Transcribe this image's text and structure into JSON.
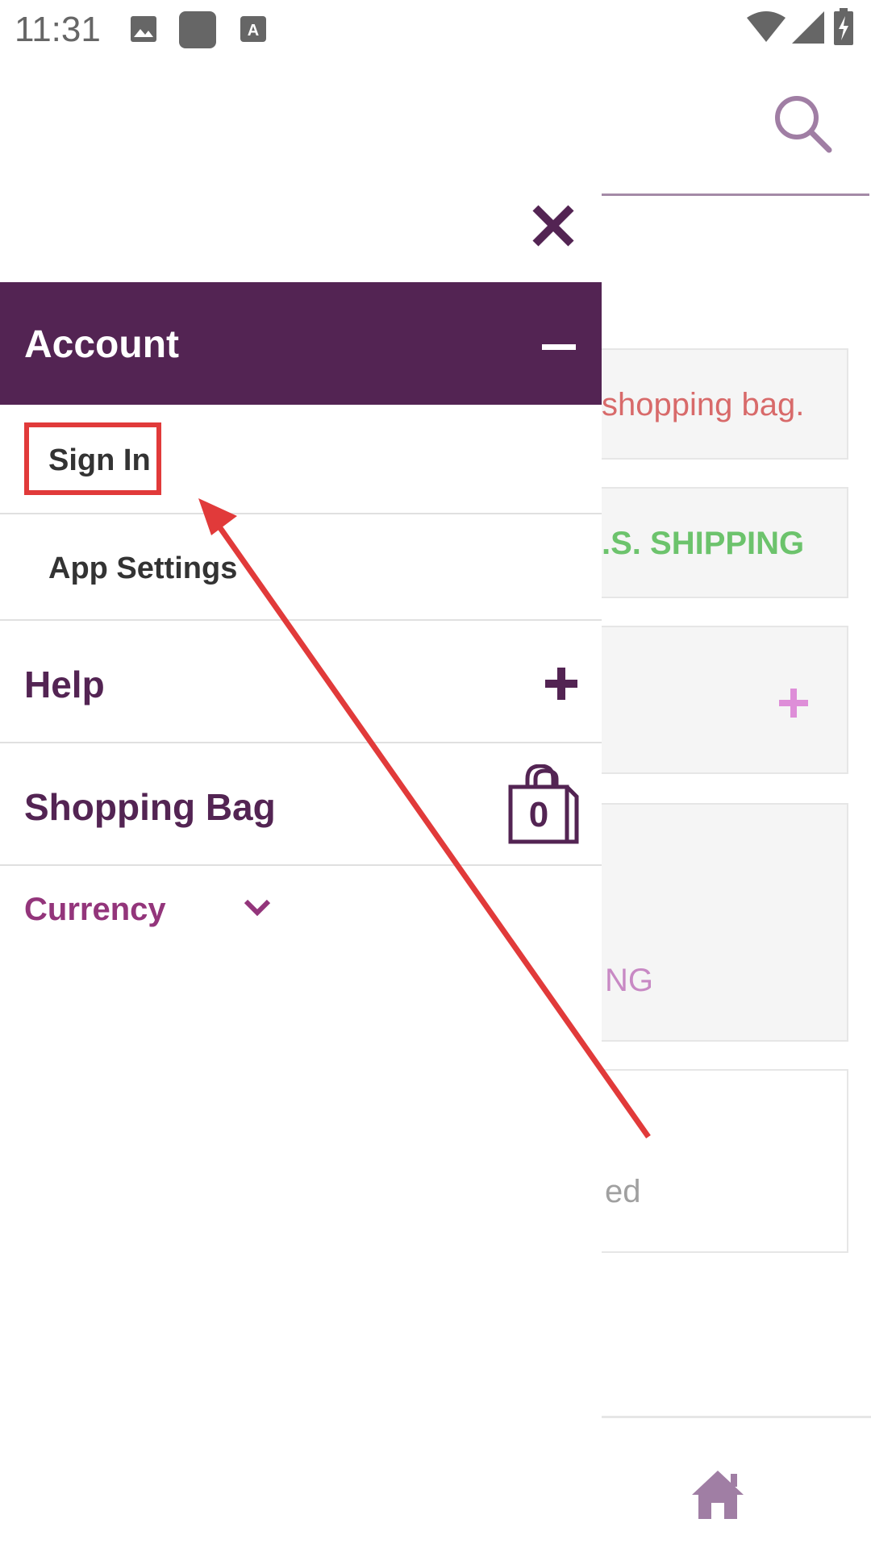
{
  "status_bar": {
    "time": "11:31"
  },
  "background": {
    "card1_text": "shopping bag.",
    "card2_text": ".S. SHIPPING",
    "card4_text": "NG",
    "card5_text": "ed",
    "colors": {
      "card1": "#d86a6a",
      "card2": "#6cc36c",
      "card4": "#c889c4",
      "card5": "#a0a0a0"
    }
  },
  "drawer": {
    "account_label": "Account",
    "sign_in_label": "Sign In",
    "app_settings_label": "App Settings",
    "help_label": "Help",
    "shopping_bag_label": "Shopping Bag",
    "bag_count": "0",
    "currency_label": "Currency"
  },
  "colors": {
    "brand": "#532453",
    "annotation_red": "#e13a3a",
    "currency": "#93357b"
  },
  "icons": [
    "search-icon",
    "close-icon",
    "minus-icon",
    "plus-icon",
    "shopping-bag-icon",
    "chevron-down-icon",
    "home-icon",
    "wifi-icon",
    "signal-icon",
    "battery-icon"
  ]
}
